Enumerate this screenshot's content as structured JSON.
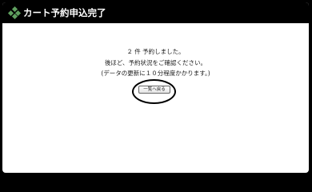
{
  "header": {
    "title": "カート予約申込完了",
    "icon": "diamond-cluster-icon",
    "background_color": "#000000",
    "icon_color": "#5fa05f"
  },
  "message": {
    "line1": "２ 件 予約しました。",
    "line2": "後ほど、予約状況をご確認ください。",
    "line3": "(データの更新に１０分程度かかります。)"
  },
  "actions": {
    "back_button_label": "一覧へ戻る"
  }
}
